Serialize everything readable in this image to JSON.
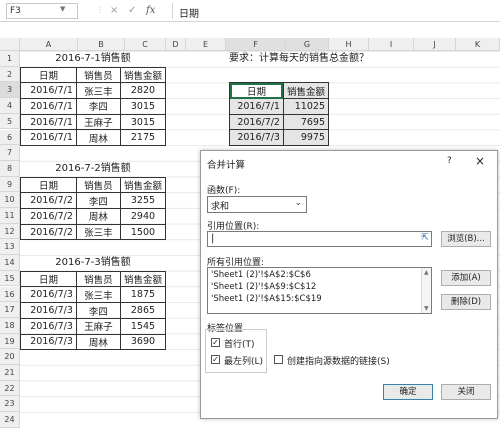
{
  "formula_bar": {
    "name_box": "F3",
    "cancel_icon": "×",
    "enter_icon": "✓",
    "fx_label": "fx",
    "value": "日期"
  },
  "columns": [
    "A",
    "B",
    "C",
    "D",
    "E",
    "F",
    "G",
    "H",
    "I",
    "J",
    "K"
  ],
  "rows": [
    "1",
    "2",
    "3",
    "4",
    "5",
    "6",
    "7",
    "8",
    "9",
    "10",
    "11",
    "12",
    "13",
    "14",
    "15",
    "16",
    "17",
    "18",
    "19",
    "20",
    "21",
    "22",
    "23",
    "24"
  ],
  "question": "要求：计算每天的销售总金额？",
  "tables": [
    {
      "title": "2016-7-1销售额",
      "headers": [
        "日期",
        "销售员",
        "销售金额"
      ],
      "rows": [
        [
          "2016/7/1",
          "张三丰",
          "2820"
        ],
        [
          "2016/7/1",
          "李四",
          "3015"
        ],
        [
          "2016/7/1",
          "王麻子",
          "3015"
        ],
        [
          "2016/7/1",
          "周林",
          "2175"
        ]
      ]
    },
    {
      "title": "2016-7-2销售额",
      "headers": [
        "日期",
        "销售员",
        "销售金额"
      ],
      "rows": [
        [
          "2016/7/2",
          "李四",
          "3255"
        ],
        [
          "2016/7/2",
          "周林",
          "2940"
        ],
        [
          "2016/7/2",
          "张三丰",
          "1500"
        ]
      ]
    },
    {
      "title": "2016-7-3销售额",
      "headers": [
        "日期",
        "销售员",
        "销售金额"
      ],
      "rows": [
        [
          "2016/7/3",
          "张三丰",
          "1875"
        ],
        [
          "2016/7/3",
          "李四",
          "2865"
        ],
        [
          "2016/7/3",
          "王麻子",
          "1545"
        ],
        [
          "2016/7/3",
          "周林",
          "3690"
        ]
      ]
    }
  ],
  "summary": {
    "headers": [
      "日期",
      "销售金额"
    ],
    "rows": [
      [
        "2016/7/1",
        "11025"
      ],
      [
        "2016/7/2",
        "7695"
      ],
      [
        "2016/7/3",
        "9975"
      ]
    ]
  },
  "dialog": {
    "title": "合并计算",
    "help": "?",
    "close": "×",
    "function_label": "函数(F):",
    "function_value": "求和",
    "dropdown_arrow": "⌄",
    "ref_label": "引用位置(R):",
    "ref_value": "",
    "collapse_icon": "⇱",
    "browse": "浏览(B)...",
    "all_refs_label": "所有引用位置:",
    "refs": [
      "'Sheet1 (2)'!$A$2:$C$6",
      "'Sheet1 (2)'!$A$9:$C$12",
      "'Sheet1 (2)'!$A$15:$C$19"
    ],
    "add": "添加(A)",
    "delete": "删除(D)",
    "label_group": "标签位置",
    "first_row": "首行(T)",
    "first_row_checked": "✓",
    "left_col": "最左列(L)",
    "left_col_checked": "✓",
    "link": "创建指向源数据的链接(S)",
    "ok": "确定",
    "close_btn": "关闭"
  }
}
